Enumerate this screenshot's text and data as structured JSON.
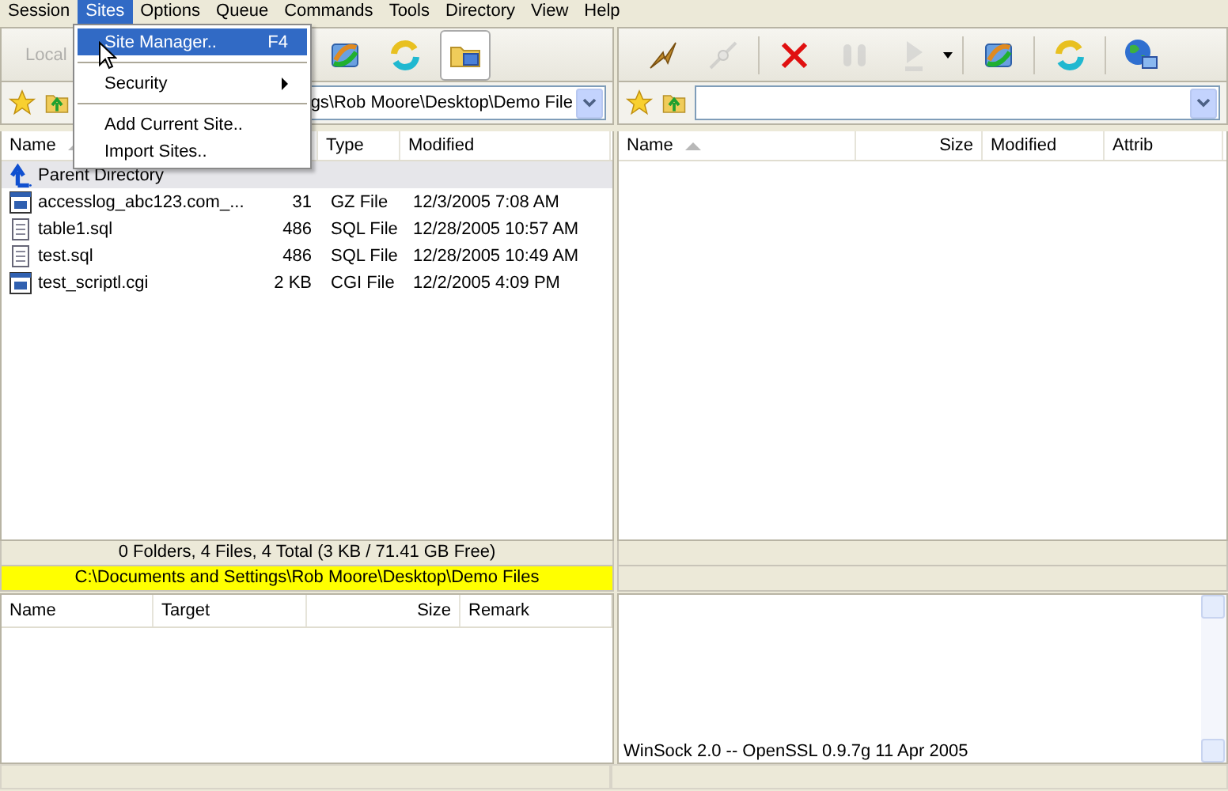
{
  "menu_bar": [
    {
      "label": "Session",
      "selected": false
    },
    {
      "label": "Sites",
      "selected": true
    },
    {
      "label": "Options",
      "selected": false
    },
    {
      "label": "Queue",
      "selected": false
    },
    {
      "label": "Commands",
      "selected": false
    },
    {
      "label": "Tools",
      "selected": false
    },
    {
      "label": "Directory",
      "selected": false
    },
    {
      "label": "View",
      "selected": false
    },
    {
      "label": "Help",
      "selected": false
    }
  ],
  "sites_menu": [
    {
      "kind": "item",
      "label": "Site Manager..",
      "shortcut": "F4",
      "selected": true
    },
    {
      "kind": "separator"
    },
    {
      "kind": "submenu",
      "label": "Security",
      "selected": false
    },
    {
      "kind": "separator"
    },
    {
      "kind": "item",
      "label": "Add Current Site..",
      "selected": false
    },
    {
      "kind": "item",
      "label": "Import Sites..",
      "selected": false
    }
  ],
  "local": {
    "toolbar": [
      {
        "kind": "label",
        "label": "Local",
        "disabled": true,
        "pressed": false
      },
      {
        "kind": "transfer",
        "disabled": false,
        "pressed": false
      },
      {
        "kind": "refresh",
        "disabled": false,
        "pressed": false
      },
      {
        "kind": "folder",
        "disabled": false,
        "pressed": true
      }
    ],
    "address": "gs\\Rob Moore\\Desktop\\Demo File",
    "columns": [
      {
        "label": "Name",
        "sorted": true
      },
      {
        "label": "Type",
        "sorted": false
      },
      {
        "label": "Modified",
        "sorted": false
      }
    ],
    "rows": [
      {
        "kind": "parent",
        "name": "Parent Directory",
        "size": "",
        "type": "",
        "modified": "",
        "selected": true
      },
      {
        "kind": "app",
        "name": "accesslog_abc123.com_...",
        "size": "31",
        "type": "GZ File",
        "modified": "12/3/2005 7:08 AM",
        "selected": false
      },
      {
        "kind": "text",
        "name": "table1.sql",
        "size": "486",
        "type": "SQL File",
        "modified": "12/28/2005 10:57 AM",
        "selected": false
      },
      {
        "kind": "text",
        "name": "test.sql",
        "size": "486",
        "type": "SQL File",
        "modified": "12/28/2005 10:49 AM",
        "selected": false
      },
      {
        "kind": "app",
        "name": "test_scriptl.cgi",
        "size": "2 KB",
        "type": "CGI File",
        "modified": "12/2/2005 4:09 PM",
        "selected": false
      }
    ],
    "summary": "0 Folders, 4 Files, 4 Total (3 KB / 71.41 GB Free)",
    "path": "C:\\Documents and Settings\\Rob Moore\\Desktop\\Demo Files"
  },
  "remote": {
    "toolbar": [
      {
        "kind": "connect",
        "disabled": false,
        "pressed": false
      },
      {
        "kind": "disconnect",
        "disabled": true,
        "pressed": false
      },
      {
        "kind": "abort",
        "disabled": false,
        "pressed": false
      },
      {
        "kind": "pause",
        "disabled": true,
        "pressed": false
      },
      {
        "kind": "go",
        "disabled": true,
        "pressed": false
      },
      {
        "kind": "transfer",
        "disabled": false,
        "pressed": false
      },
      {
        "kind": "refresh",
        "disabled": false,
        "pressed": false
      },
      {
        "kind": "globe",
        "disabled": false,
        "pressed": false
      }
    ],
    "columns": [
      {
        "label": "Name",
        "sorted": true
      },
      {
        "label": "Size",
        "sorted": false
      },
      {
        "label": "Modified",
        "sorted": false
      },
      {
        "label": "Attrib",
        "sorted": false
      }
    ]
  },
  "queue": {
    "columns": [
      {
        "label": "Name"
      },
      {
        "label": "Target"
      },
      {
        "label": "Size"
      },
      {
        "label": "Remark"
      }
    ]
  },
  "log": [
    "WinSock 2.0 -- OpenSSL 0.9.7g 11 Apr 2005"
  ]
}
